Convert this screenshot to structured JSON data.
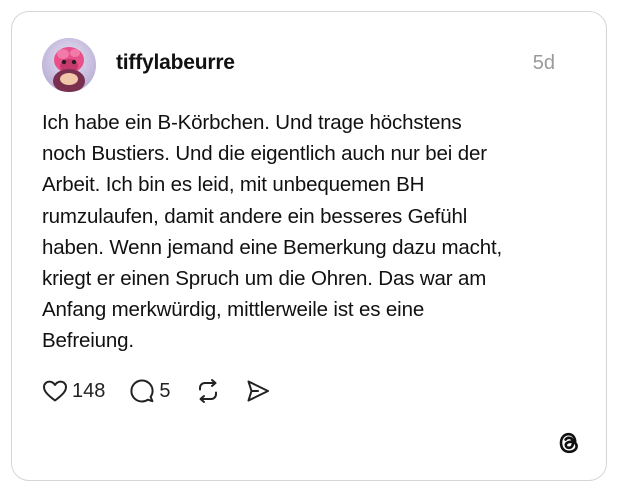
{
  "post": {
    "username": "tiffylabeurre",
    "timestamp": "5d",
    "text": "Ich habe ein B-Körbchen. Und trage höchstens\nnoch Bustiers. Und die eigentlich auch nur bei der\nArbeit. Ich bin es leid, mit unbequemen BH\nrumzulaufen, damit andere ein besseres Gefühl\nhaben. Wenn jemand eine Bemerkung dazu macht,\nkriegt er einen Spruch um die Ohren. Das war am\nAnfang merkwürdig, mittlerweile ist es eine\nBefreiung."
  },
  "actions": {
    "like_count": "148",
    "reply_count": "5",
    "icons": [
      "heart-icon",
      "reply-bubble-icon",
      "repost-icon",
      "share-icon"
    ]
  },
  "branding": {
    "logo_icon": "threads-logo-icon"
  },
  "colors": {
    "border": "#d6d6d6",
    "timestamp": "#9a9a9a",
    "text": "#111111"
  }
}
